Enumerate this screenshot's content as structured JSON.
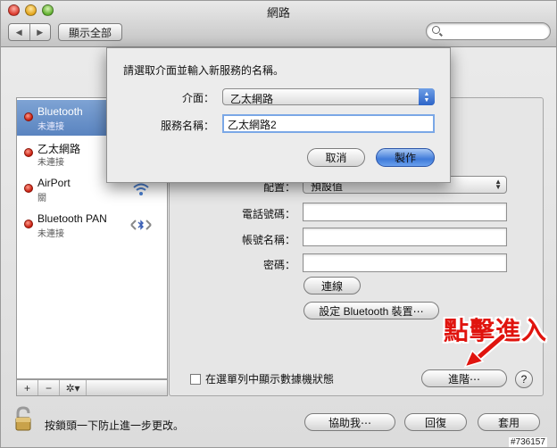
{
  "window": {
    "title": "網路",
    "show_all": "顯示全部"
  },
  "services": [
    {
      "name": "Bluetooth",
      "status": "未連接",
      "icon": "bluetooth-icon"
    },
    {
      "name": "乙太網路",
      "status": "未連接",
      "icon": "ethernet-icon"
    },
    {
      "name": "AirPort",
      "status": "關",
      "icon": "airport-icon"
    },
    {
      "name": "Bluetooth PAN",
      "status": "未連接",
      "icon": "bluetooth-pan-icon"
    }
  ],
  "list_toolbar": {
    "add": "+",
    "remove": "−",
    "gear": "✲▾"
  },
  "detail": {
    "config_label": "配置：",
    "config_value": "預設值",
    "phone_label": "電話號碼：",
    "account_label": "帳號名稱：",
    "password_label": "密碼：",
    "connect_button": "連線",
    "bt_settings_button": "設定 Bluetooth 裝置⋯",
    "show_modem_status": "在選單列中顯示數據機狀態",
    "advanced_button": "進階⋯",
    "help_button": "?"
  },
  "annotation": {
    "text": "點擊進入",
    "color": "#e0140e"
  },
  "footer": {
    "lock_text": "按鎖頭一下防止進一步更改。",
    "assist_button": "協助我⋯",
    "revert_button": "回復",
    "apply_button": "套用"
  },
  "sheet": {
    "prompt": "請選取介面並輸入新服務的名稱。",
    "interface_label": "介面：",
    "interface_value": "乙太網路",
    "service_name_label": "服務名稱：",
    "service_name_value": "乙太網路2",
    "cancel_button": "取消",
    "create_button": "製作"
  },
  "watermark": "#736157"
}
